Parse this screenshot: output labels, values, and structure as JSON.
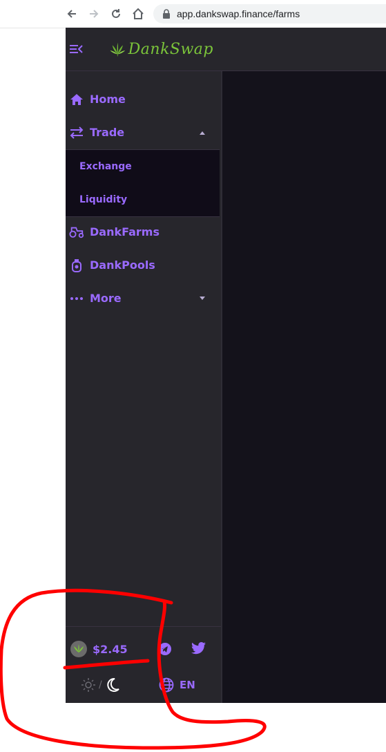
{
  "browser": {
    "url": "app.dankswap.finance/farms",
    "back_icon": "arrow-left-icon",
    "forward_icon": "arrow-right-icon",
    "reload_icon": "reload-icon",
    "home_icon": "home-icon",
    "lock_icon": "lock-icon"
  },
  "header": {
    "logo_text": "DankSwap",
    "menu_toggle_icon": "menu-collapse-icon"
  },
  "sidebar": {
    "items": [
      {
        "label": "Home",
        "icon": "home-icon"
      },
      {
        "label": "Trade",
        "icon": "swap-icon",
        "expanded": true
      },
      {
        "label": "DankFarms",
        "icon": "tractor-icon"
      },
      {
        "label": "DankPools",
        "icon": "pool-icon"
      },
      {
        "label": "More",
        "icon": "more-icon",
        "expanded": false
      }
    ],
    "trade_submenu": [
      {
        "label": "Exchange"
      },
      {
        "label": "Liquidity"
      }
    ]
  },
  "footer": {
    "token_price": "$2.45",
    "token_icon": "cannabis-leaf-icon",
    "telegram_icon": "telegram-icon",
    "twitter_icon": "twitter-icon",
    "theme_light_icon": "sun-icon",
    "theme_dark_icon": "moon-icon",
    "theme_separator": "/",
    "language": "EN",
    "language_icon": "globe-icon"
  },
  "colors": {
    "accent": "#9a6aff",
    "sidebar_bg": "#27262c",
    "content_bg": "#14121b",
    "submenu_bg": "#100c18",
    "logo_green": "#7bc43a",
    "annotation_red": "#ff0000"
  }
}
